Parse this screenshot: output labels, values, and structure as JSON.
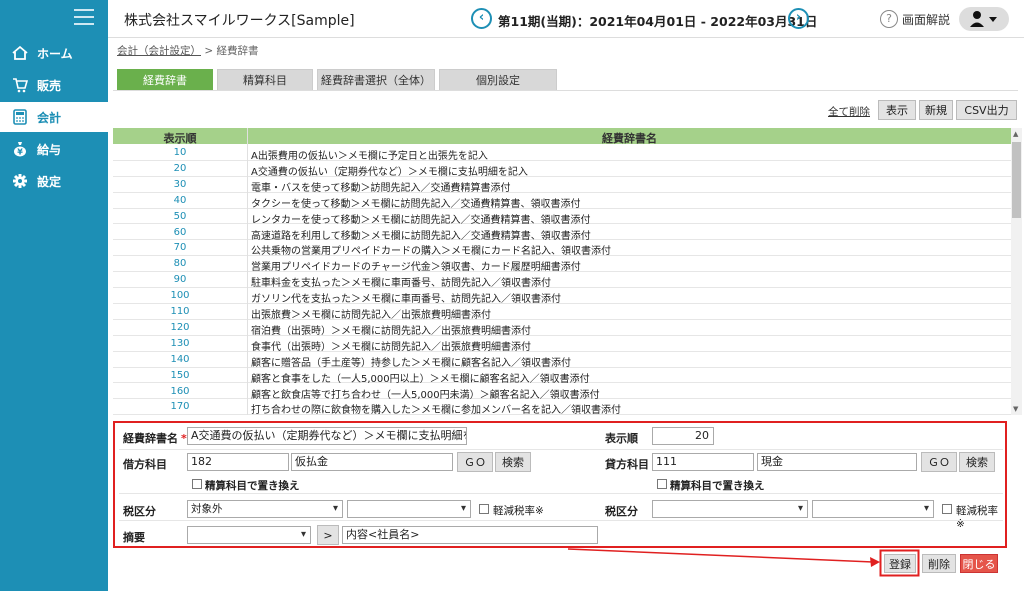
{
  "nav": {
    "items": [
      {
        "label": "ホーム",
        "icon": "home-icon"
      },
      {
        "label": "販売",
        "icon": "cart-icon"
      },
      {
        "label": "会計",
        "icon": "calculator-icon"
      },
      {
        "label": "給与",
        "icon": "money-bag-icon"
      },
      {
        "label": "設定",
        "icon": "gear-icon"
      }
    ]
  },
  "header": {
    "company": "株式会社スマイルワークス[Sample]",
    "period": "第11期(当期)：2021年04月01日 - 2022年03月31日",
    "help": "画面解説"
  },
  "breadcrumb": {
    "parent": "会計（会計設定）",
    "sep": ">",
    "current": "経費辞書"
  },
  "tabs": [
    "経費辞書",
    "精算科目",
    "経費辞書選択（全体）",
    "個別設定"
  ],
  "toolbar": {
    "clear_all": "全て削除",
    "show": "表示",
    "new": "新規",
    "csv": "CSV出力"
  },
  "table": {
    "headers": [
      "表示順",
      "経費辞書名"
    ],
    "rows": [
      {
        "order": "10",
        "name": "A出張費用の仮払い＞メモ欄に予定日と出張先を記入"
      },
      {
        "order": "20",
        "name": "A交通費の仮払い（定期券代など）＞メモ欄に支払明細を記入"
      },
      {
        "order": "30",
        "name": "電車・バスを使って移動＞訪問先記入／交通費精算書添付"
      },
      {
        "order": "40",
        "name": "タクシーを使って移動＞メモ欄に訪問先記入／交通費精算書、領収書添付"
      },
      {
        "order": "50",
        "name": "レンタカーを使って移動＞メモ欄に訪問先記入／交通費精算書、領収書添付"
      },
      {
        "order": "60",
        "name": "高速道路を利用して移動＞メモ欄に訪問先記入／交通費精算書、領収書添付"
      },
      {
        "order": "70",
        "name": "公共乗物の営業用プリペイドカードの購入＞メモ欄にカード名記入、領収書添付"
      },
      {
        "order": "80",
        "name": "営業用プリペイドカードのチャージ代金＞領収書、カード履歴明細書添付"
      },
      {
        "order": "90",
        "name": "駐車料金を支払った＞メモ欄に車両番号、訪問先記入／領収書添付"
      },
      {
        "order": "100",
        "name": "ガソリン代を支払った＞メモ欄に車両番号、訪問先記入／領収書添付"
      },
      {
        "order": "110",
        "name": "出張旅費＞メモ欄に訪問先記入／出張旅費明細書添付"
      },
      {
        "order": "120",
        "name": "宿泊費（出張時）＞メモ欄に訪問先記入／出張旅費明細書添付"
      },
      {
        "order": "130",
        "name": "食事代（出張時）＞メモ欄に訪問先記入／出張旅費明細書添付"
      },
      {
        "order": "140",
        "name": "顧客に贈答品（手土産等）持参した＞メモ欄に顧客名記入／領収書添付"
      },
      {
        "order": "150",
        "name": "顧客と食事をした（一人5,000円以上）＞メモ欄に顧客名記入／領収書添付"
      },
      {
        "order": "160",
        "name": "顧客と飲食店等で打ち合わせ（一人5,000円未満）＞顧客名記入／領収書添付"
      },
      {
        "order": "170",
        "name": "打ち合わせの際に飲食物を購入した＞メモ欄に参加メンバー名を記入／領収書添付"
      }
    ]
  },
  "form": {
    "name_label": "経費辞書名",
    "required_mark": "*",
    "name_value": "A交通費の仮払い（定期券代など）＞メモ欄に支払明細を記入",
    "order_label": "表示順",
    "order_value": "20",
    "debit_label": "借方科目",
    "debit_code": "182",
    "debit_name": "仮払金",
    "credit_label": "貸方科目",
    "credit_code": "111",
    "credit_name": "現金",
    "go": "ＧＯ",
    "search": "検索",
    "replace_label": "精算科目で置き換え",
    "tax_label": "税区分",
    "tax_value": "対象外",
    "reduced_label": "軽減税率※",
    "memo_label": "摘要",
    "memo_arrow": ">",
    "memo_value": "内容<社員名>"
  },
  "actions": {
    "register": "登録",
    "delete": "削除",
    "close": "閉じる"
  },
  "colors": {
    "accent": "#1d8fb5",
    "tab_active": "#6ab04c",
    "table_header": "#a5d18a",
    "highlight": "#e02020"
  }
}
